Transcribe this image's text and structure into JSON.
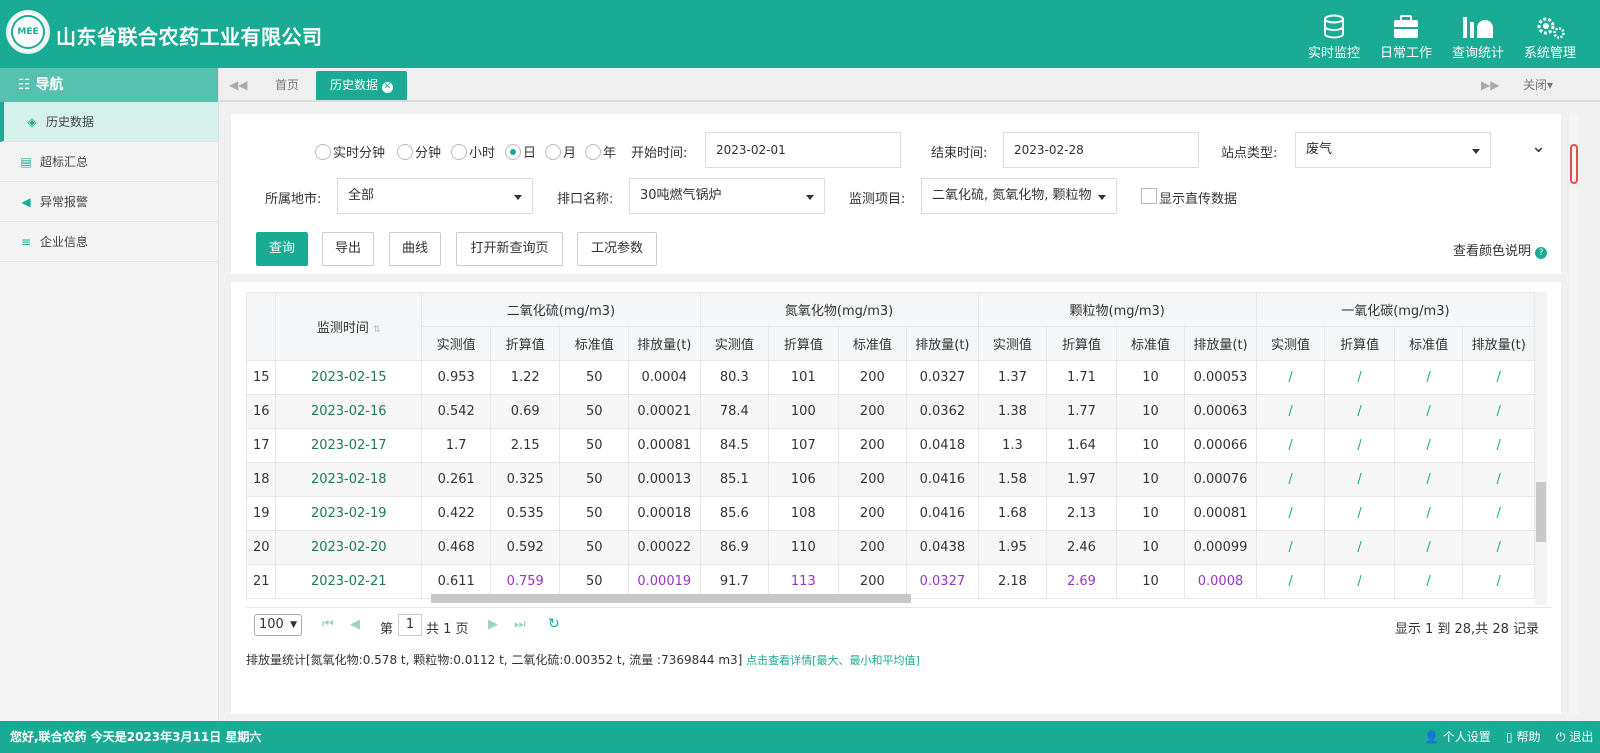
{
  "app": {
    "title": "山东省联合农药工业有限公司",
    "logo_text": "MEE"
  },
  "topnav": [
    {
      "label": "实时监控",
      "icon": "database-icon"
    },
    {
      "label": "日常工作",
      "icon": "briefcase-icon"
    },
    {
      "label": "查询统计",
      "icon": "bar-chart-icon"
    },
    {
      "label": "系统管理",
      "icon": "gears-icon"
    }
  ],
  "sidebar": {
    "header": "导航",
    "items": [
      {
        "label": "历史数据",
        "icon": "layers-icon",
        "active": true
      },
      {
        "label": "超标汇总",
        "icon": "clipboard-icon"
      },
      {
        "label": "异常报警",
        "icon": "speaker-icon"
      },
      {
        "label": "企业信息",
        "icon": "list-icon"
      }
    ]
  },
  "tabs": {
    "home": "首页",
    "current": "历史数据",
    "close_menu": "关闭"
  },
  "filters": {
    "radios": [
      "实时分钟",
      "分钟",
      "小时",
      "日",
      "月",
      "年"
    ],
    "radio_selected": "日",
    "start_label": "开始时间:",
    "start_value": "2023-02-01",
    "end_label": "结束时间:",
    "end_value": "2023-02-28",
    "site_type_label": "站点类型:",
    "site_type_value": "废气",
    "city_label": "所属地市:",
    "city_value": "全部",
    "outlet_label": "排口名称:",
    "outlet_value": "30吨燃气锅炉",
    "item_label": "监测项目:",
    "item_value": "二氧化硫, 氮氧化物, 颗粒物",
    "direct_label": "显示直传数据",
    "color_help": "查看颜色说明"
  },
  "buttons": {
    "query": "查询",
    "export": "导出",
    "curve": "曲线",
    "open_new": "打开新查询页",
    "params": "工况参数"
  },
  "table": {
    "time_header": "监测时间",
    "groups": [
      "二氧化硫(mg/m3)",
      "氮氧化物(mg/m3)",
      "颗粒物(mg/m3)",
      "一氧化碳(mg/m3)"
    ],
    "subheaders": [
      "实测值",
      "折算值",
      "标准值",
      "排放量(t)"
    ],
    "rows": [
      {
        "n": "15",
        "date": "2023-02-15",
        "v": [
          "0.953",
          "1.22",
          "50",
          "0.0004",
          "80.3",
          "101",
          "200",
          "0.0327",
          "1.37",
          "1.71",
          "10",
          "0.00053",
          "/",
          "/",
          "/",
          "/"
        ],
        "pur": []
      },
      {
        "n": "16",
        "date": "2023-02-16",
        "v": [
          "0.542",
          "0.69",
          "50",
          "0.00021",
          "78.4",
          "100",
          "200",
          "0.0362",
          "1.38",
          "1.77",
          "10",
          "0.00063",
          "/",
          "/",
          "/",
          "/"
        ],
        "pur": []
      },
      {
        "n": "17",
        "date": "2023-02-17",
        "v": [
          "1.7",
          "2.15",
          "50",
          "0.00081",
          "84.5",
          "107",
          "200",
          "0.0418",
          "1.3",
          "1.64",
          "10",
          "0.00066",
          "/",
          "/",
          "/",
          "/"
        ],
        "pur": []
      },
      {
        "n": "18",
        "date": "2023-02-18",
        "v": [
          "0.261",
          "0.325",
          "50",
          "0.00013",
          "85.1",
          "106",
          "200",
          "0.0416",
          "1.58",
          "1.97",
          "10",
          "0.00076",
          "/",
          "/",
          "/",
          "/"
        ],
        "pur": []
      },
      {
        "n": "19",
        "date": "2023-02-19",
        "v": [
          "0.422",
          "0.535",
          "50",
          "0.00018",
          "85.6",
          "108",
          "200",
          "0.0416",
          "1.68",
          "2.13",
          "10",
          "0.00081",
          "/",
          "/",
          "/",
          "/"
        ],
        "pur": []
      },
      {
        "n": "20",
        "date": "2023-02-20",
        "v": [
          "0.468",
          "0.592",
          "50",
          "0.00022",
          "86.9",
          "110",
          "200",
          "0.0438",
          "1.95",
          "2.46",
          "10",
          "0.00099",
          "/",
          "/",
          "/",
          "/"
        ],
        "pur": []
      },
      {
        "n": "21",
        "date": "2023-02-21",
        "v": [
          "0.611",
          "0.759",
          "50",
          "0.00019",
          "91.7",
          "113",
          "200",
          "0.0327",
          "2.18",
          "2.69",
          "10",
          "0.0008",
          "/",
          "/",
          "/",
          "/"
        ],
        "pur": [
          1,
          3,
          5,
          7,
          9,
          11
        ]
      }
    ]
  },
  "pager": {
    "page_size": "100",
    "page_prefix": "第",
    "page": "1",
    "page_suffix": "共 1 页",
    "summary": "显示 1 到 28,共 28 记录"
  },
  "emission_stats": {
    "text": "排放量统计[氮氧化物:0.578 t, 颗粒物:0.0112 t, 二氧化硫:0.00352 t, 流量 :7369844 m3]",
    "link": "点击查看详情[最大、最小和平均值]"
  },
  "footer": {
    "greeting": "您好,联合农药 今天是2023年3月11日 星期六",
    "personal": "个人设置",
    "help": "帮助",
    "logout": "退出"
  }
}
